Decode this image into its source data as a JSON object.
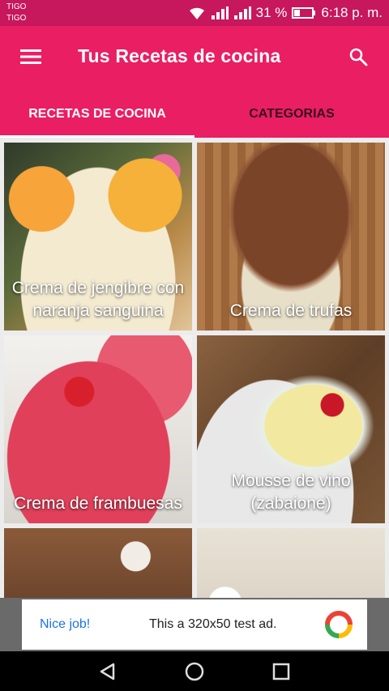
{
  "status_bar": {
    "carrier_line1": "TIGO",
    "carrier_line2": "TIGO",
    "battery": "31 %",
    "time": "6:18 p. m."
  },
  "app_bar": {
    "title": "Tus Recetas de cocina",
    "menu_icon": "hamburger-menu-icon",
    "search_icon": "search-icon"
  },
  "tabs": [
    {
      "label": "RECETAS DE COCINA",
      "active": true
    },
    {
      "label": "CATEGORIAS",
      "active": false
    }
  ],
  "recipes": [
    {
      "name": "Crema de jengibre con naranja sanguina"
    },
    {
      "name": "Crema de trufas"
    },
    {
      "name": "Crema de frambuesas"
    },
    {
      "name": "Mousse de vino (zabaione)"
    },
    {
      "name": ""
    },
    {
      "name": ""
    }
  ],
  "ad": {
    "nice_label": "Nice job!",
    "text": "This a 320x50 test ad."
  },
  "colors": {
    "primary": "#e91e63",
    "status_bar": "#c7175d",
    "inactive_tab_text": "#3a0b1c"
  }
}
